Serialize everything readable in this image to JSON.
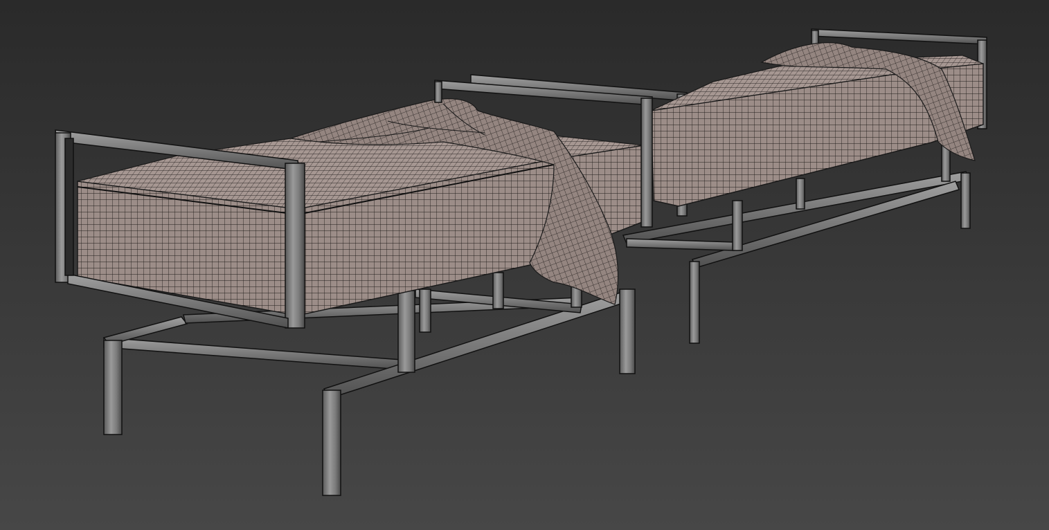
{
  "viewport": {
    "background_top": "#2a2a2a",
    "background_bottom": "#474747"
  },
  "scene": {
    "objects": [
      {
        "name": "bed-left",
        "parts": [
          "metal-frame",
          "mattress",
          "draped-blanket"
        ]
      },
      {
        "name": "bed-right",
        "parts": [
          "metal-frame",
          "mattress",
          "draped-blanket"
        ]
      }
    ],
    "render_style": "wireframe-on-shaded",
    "colors": {
      "fabric": "#9c8d88",
      "fabric_shade": "#857773",
      "metal": "#8a8a8a",
      "metal_dark": "#5c5c5c",
      "wire": "#1a1a1a"
    }
  }
}
